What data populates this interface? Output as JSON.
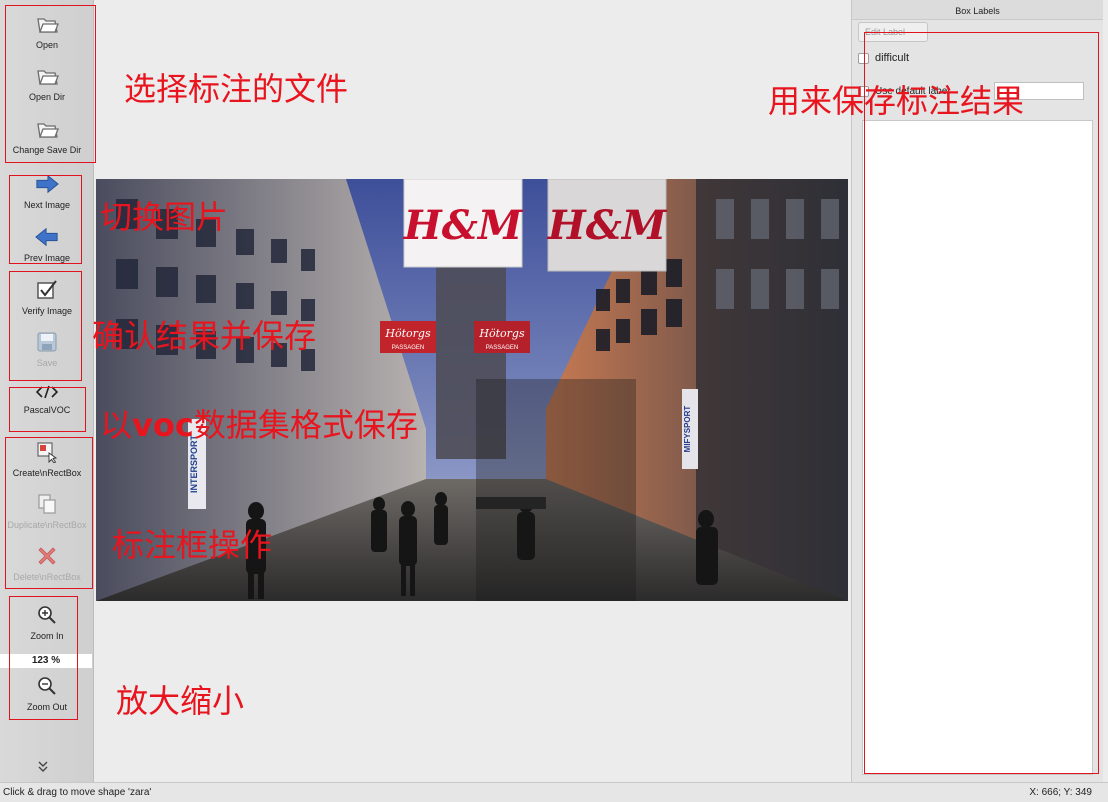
{
  "toolbar": {
    "open": "Open",
    "open_dir": "Open Dir",
    "change_save_dir": "Change Save Dir",
    "next_image": "Next Image",
    "prev_image": "Prev Image",
    "verify_image": "Verify Image",
    "save": "Save",
    "format": "PascalVOC",
    "create_rectbox": "Create\\nRectBox",
    "duplicate_rectbox": "Duplicate\\nRectBox",
    "delete_rectbox": "Delete\\nRectBox",
    "zoom_in": "Zoom In",
    "zoom_value": "123 %",
    "zoom_out": "Zoom Out",
    "more": "»"
  },
  "annotations": {
    "files": "选择标注的文件",
    "switch": "切换图片",
    "confirm": "确认结果并保存",
    "voc_prefix": "以",
    "voc_bold": "voc",
    "voc_suffix": "数据集格式保存",
    "box_ops": "标注框操作",
    "zoom": "放大缩小",
    "result": "用来保存标注结果"
  },
  "right_panel": {
    "title": "Box Labels",
    "edit_label": "Edit Label",
    "difficult": "difficult",
    "use_default_label": "Use default label"
  },
  "photo": {
    "sign_main_left": "H&M",
    "sign_main_right": "H&M",
    "sign_small_1": "Hötorgs",
    "sign_small_1_sub": "PASSAGEN",
    "sign_small_2": "Hötorgs",
    "sign_small_2_sub": "PASSAGEN",
    "sign_side_left": "INTERSPORT",
    "sign_side_right": "MIFYSPORT"
  },
  "status": {
    "message": "Click & drag to move shape 'zara'",
    "coords": "X: 666; Y: 349"
  },
  "colors": {
    "annotation_red": "#e0141e",
    "hm_red": "#c8102e"
  }
}
